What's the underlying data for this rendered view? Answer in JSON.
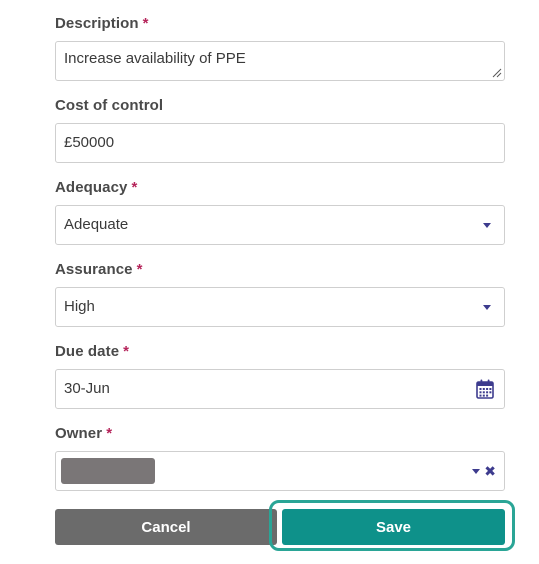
{
  "form": {
    "description": {
      "label": "Description",
      "required": "*",
      "value": "Increase availability of PPE"
    },
    "cost": {
      "label": "Cost of control",
      "value": "£50000"
    },
    "adequacy": {
      "label": "Adequacy",
      "required": "*",
      "value": "Adequate"
    },
    "assurance": {
      "label": "Assurance",
      "required": "*",
      "value": "High"
    },
    "due_date": {
      "label": "Due date",
      "required": "*",
      "value": "30-Jun"
    },
    "owner": {
      "label": "Owner",
      "required": "*",
      "clear_glyph": "✖"
    }
  },
  "actions": {
    "cancel_label": "Cancel",
    "save_label": "Save"
  },
  "colors": {
    "required": "#b5245a",
    "accent_icon": "#3d3b8e",
    "save_bg": "#0e918a",
    "save_focus": "#2aa596",
    "cancel_bg": "#6b6b6b"
  },
  "icons": {
    "calendar": "calendar-icon",
    "caret": "chevron-down-icon",
    "clear": "close-icon"
  }
}
